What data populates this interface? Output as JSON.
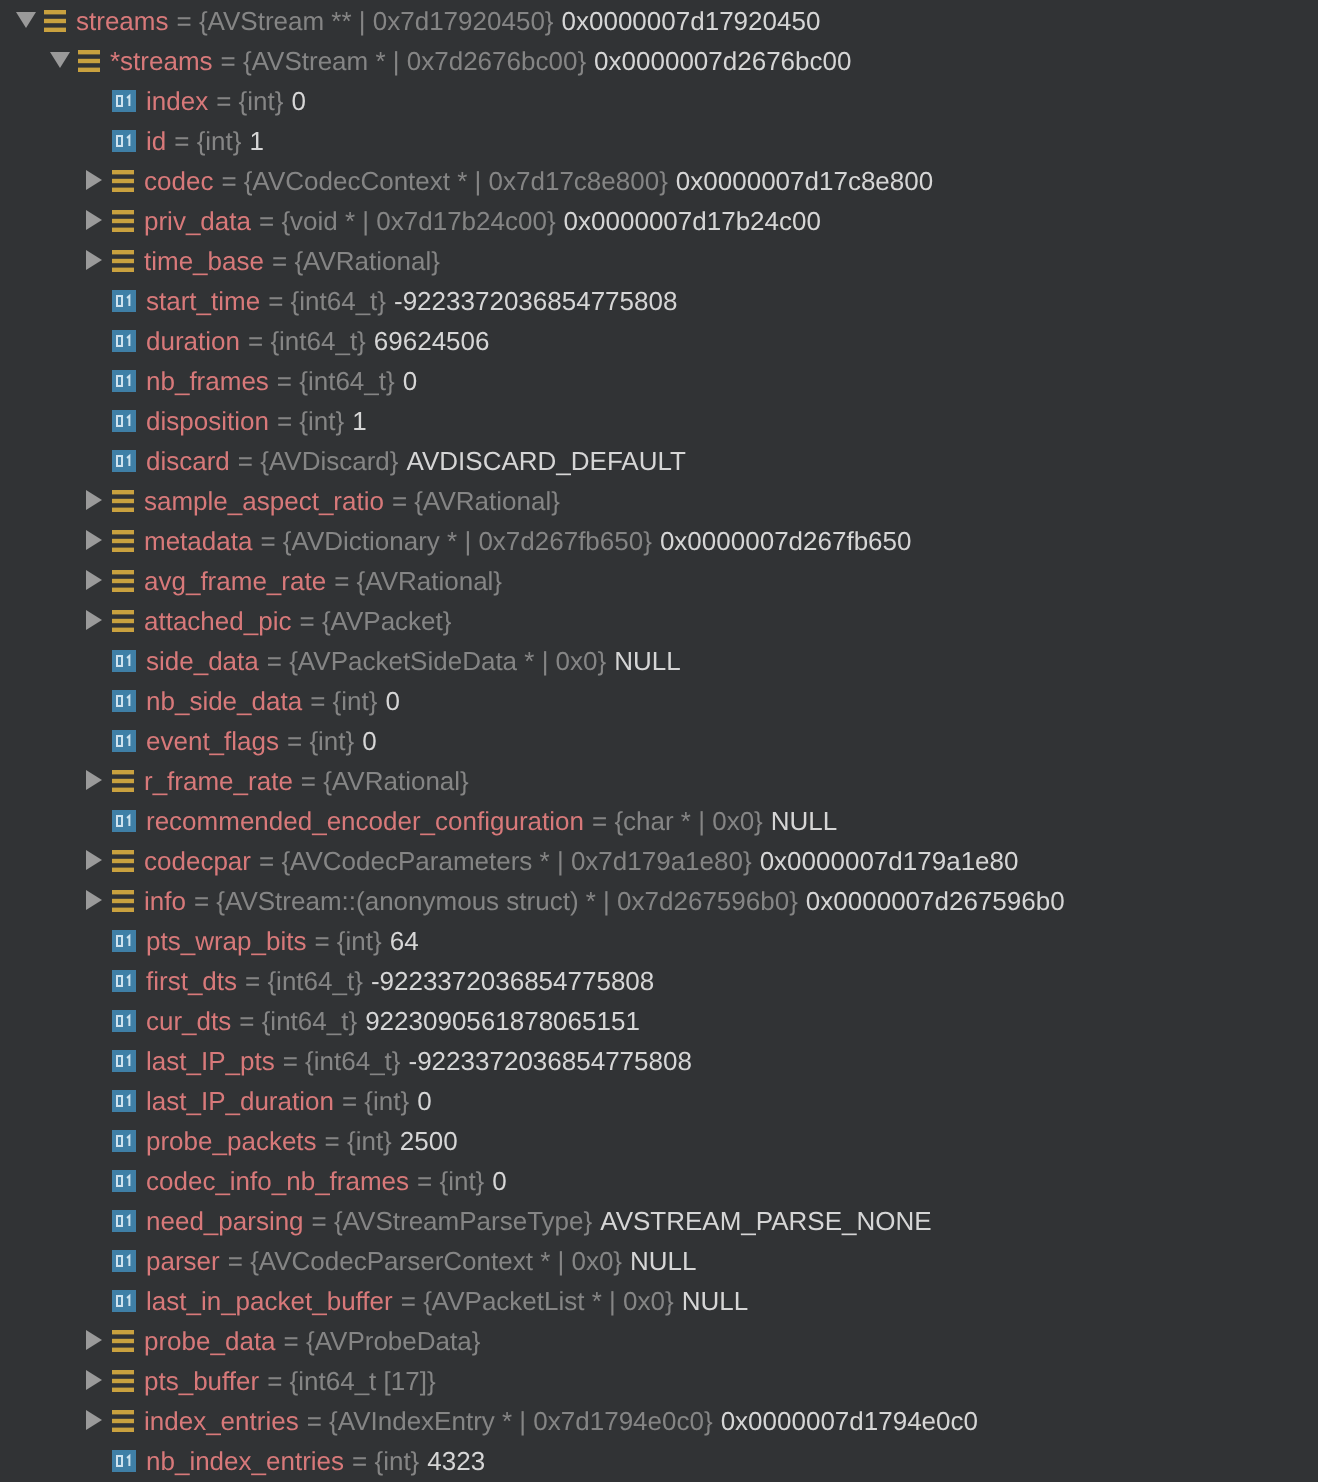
{
  "tree": [
    {
      "name": "streams",
      "type": "= {AVStream ** | 0x7d17920450}",
      "value": "0x0000007d17920450",
      "kind": "struct",
      "expanded": true,
      "children": [
        {
          "name": "*streams",
          "type": "= {AVStream * | 0x7d2676bc00}",
          "value": "0x0000007d2676bc00",
          "kind": "struct",
          "expanded": true,
          "children": [
            {
              "name": "index",
              "type": "= {int}",
              "value": "0",
              "kind": "value"
            },
            {
              "name": "id",
              "type": "= {int}",
              "value": "1",
              "kind": "value"
            },
            {
              "name": "codec",
              "type": "= {AVCodecContext * | 0x7d17c8e800}",
              "value": "0x0000007d17c8e800",
              "kind": "struct",
              "expanded": false
            },
            {
              "name": "priv_data",
              "type": "= {void * | 0x7d17b24c00}",
              "value": "0x0000007d17b24c00",
              "kind": "struct",
              "expanded": false
            },
            {
              "name": "time_base",
              "type": "= {AVRational}",
              "kind": "struct",
              "expanded": false
            },
            {
              "name": "start_time",
              "type": "= {int64_t}",
              "value": "-9223372036854775808",
              "kind": "value"
            },
            {
              "name": "duration",
              "type": "= {int64_t}",
              "value": "69624506",
              "kind": "value"
            },
            {
              "name": "nb_frames",
              "type": "= {int64_t}",
              "value": "0",
              "kind": "value"
            },
            {
              "name": "disposition",
              "type": "= {int}",
              "value": "1",
              "kind": "value"
            },
            {
              "name": "discard",
              "type": "= {AVDiscard}",
              "value": "AVDISCARD_DEFAULT",
              "kind": "value"
            },
            {
              "name": "sample_aspect_ratio",
              "type": "= {AVRational}",
              "kind": "struct",
              "expanded": false
            },
            {
              "name": "metadata",
              "type": "= {AVDictionary * | 0x7d267fb650}",
              "value": "0x0000007d267fb650",
              "kind": "struct",
              "expanded": false
            },
            {
              "name": "avg_frame_rate",
              "type": "= {AVRational}",
              "kind": "struct",
              "expanded": false
            },
            {
              "name": "attached_pic",
              "type": "= {AVPacket}",
              "kind": "struct",
              "expanded": false
            },
            {
              "name": "side_data",
              "type": "= {AVPacketSideData * | 0x0}",
              "value": "NULL",
              "kind": "value"
            },
            {
              "name": "nb_side_data",
              "type": "= {int}",
              "value": "0",
              "kind": "value"
            },
            {
              "name": "event_flags",
              "type": "= {int}",
              "value": "0",
              "kind": "value"
            },
            {
              "name": "r_frame_rate",
              "type": "= {AVRational}",
              "kind": "struct",
              "expanded": false
            },
            {
              "name": "recommended_encoder_configuration",
              "type": "= {char * | 0x0}",
              "value": "NULL",
              "kind": "value"
            },
            {
              "name": "codecpar",
              "type": "= {AVCodecParameters * | 0x7d179a1e80}",
              "value": "0x0000007d179a1e80",
              "kind": "struct",
              "expanded": false
            },
            {
              "name": "info",
              "type": "= {AVStream::(anonymous struct) * | 0x7d267596b0}",
              "value": "0x0000007d267596b0",
              "kind": "struct",
              "expanded": false
            },
            {
              "name": "pts_wrap_bits",
              "type": "= {int}",
              "value": "64",
              "kind": "value"
            },
            {
              "name": "first_dts",
              "type": "= {int64_t}",
              "value": "-9223372036854775808",
              "kind": "value"
            },
            {
              "name": "cur_dts",
              "type": "= {int64_t}",
              "value": "9223090561878065151",
              "kind": "value"
            },
            {
              "name": "last_IP_pts",
              "type": "= {int64_t}",
              "value": "-9223372036854775808",
              "kind": "value"
            },
            {
              "name": "last_IP_duration",
              "type": "= {int}",
              "value": "0",
              "kind": "value"
            },
            {
              "name": "probe_packets",
              "type": "= {int}",
              "value": "2500",
              "kind": "value"
            },
            {
              "name": "codec_info_nb_frames",
              "type": "= {int}",
              "value": "0",
              "kind": "value"
            },
            {
              "name": "need_parsing",
              "type": "= {AVStreamParseType}",
              "value": "AVSTREAM_PARSE_NONE",
              "kind": "value"
            },
            {
              "name": "parser",
              "type": "= {AVCodecParserContext * | 0x0}",
              "value": "NULL",
              "kind": "value"
            },
            {
              "name": "last_in_packet_buffer",
              "type": "= {AVPacketList * | 0x0}",
              "value": "NULL",
              "kind": "value"
            },
            {
              "name": "probe_data",
              "type": "= {AVProbeData}",
              "kind": "struct",
              "expanded": false
            },
            {
              "name": "pts_buffer",
              "type": "= {int64_t [17]}",
              "kind": "struct",
              "expanded": false
            },
            {
              "name": "index_entries",
              "type": "= {AVIndexEntry * | 0x7d1794e0c0}",
              "value": "0x0000007d1794e0c0",
              "kind": "struct",
              "expanded": false
            },
            {
              "name": "nb_index_entries",
              "type": "= {int}",
              "value": "4323",
              "kind": "value"
            }
          ]
        }
      ]
    }
  ]
}
